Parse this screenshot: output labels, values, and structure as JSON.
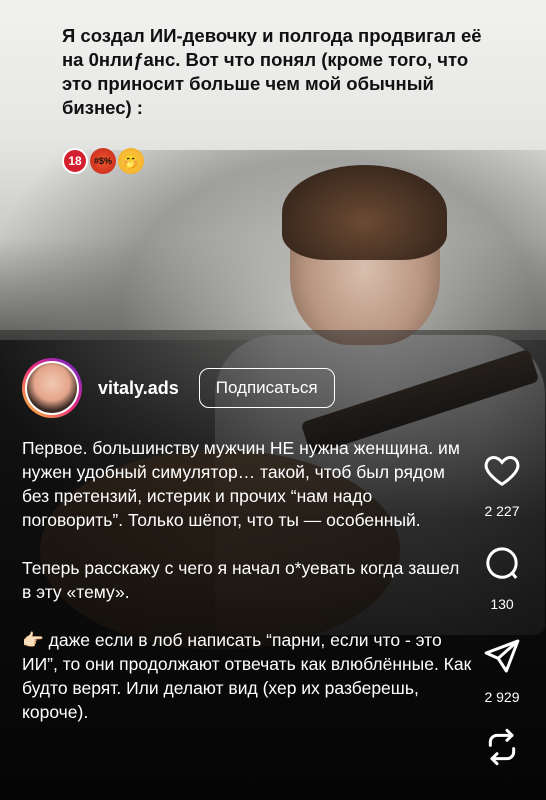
{
  "caption": "Я создал ИИ-девочку и полгода продвигал её на 0нлиƒанс. Вот что понял (кроме того, что это приносит больше чем мой обычный бизнес) :",
  "emojis": [
    "18",
    "#$%",
    "🤭"
  ],
  "profile": {
    "username": "vitaly.ads",
    "follow_label": "Подписаться"
  },
  "body": {
    "p1": "Первое. большинству мужчин НЕ нужна женщина. им нужен удобный симулятор… такой, чтоб был рядом без претензий, истерик и прочих “нам надо поговорить”. Только шёпот, что ты — особенный.",
    "p2": "Теперь расскажу с чего я начал о*уевать когда зашел в эту «тему».",
    "p3": "👉🏻 даже если в лоб написать “парни, если что - это ИИ”, то они продолжают отвечать как влюблённые. Как будто верят. Или делают вид (хер их разберешь, короче)."
  },
  "actions": {
    "likes": "2 227",
    "comments": "130",
    "shares": "2 929"
  }
}
